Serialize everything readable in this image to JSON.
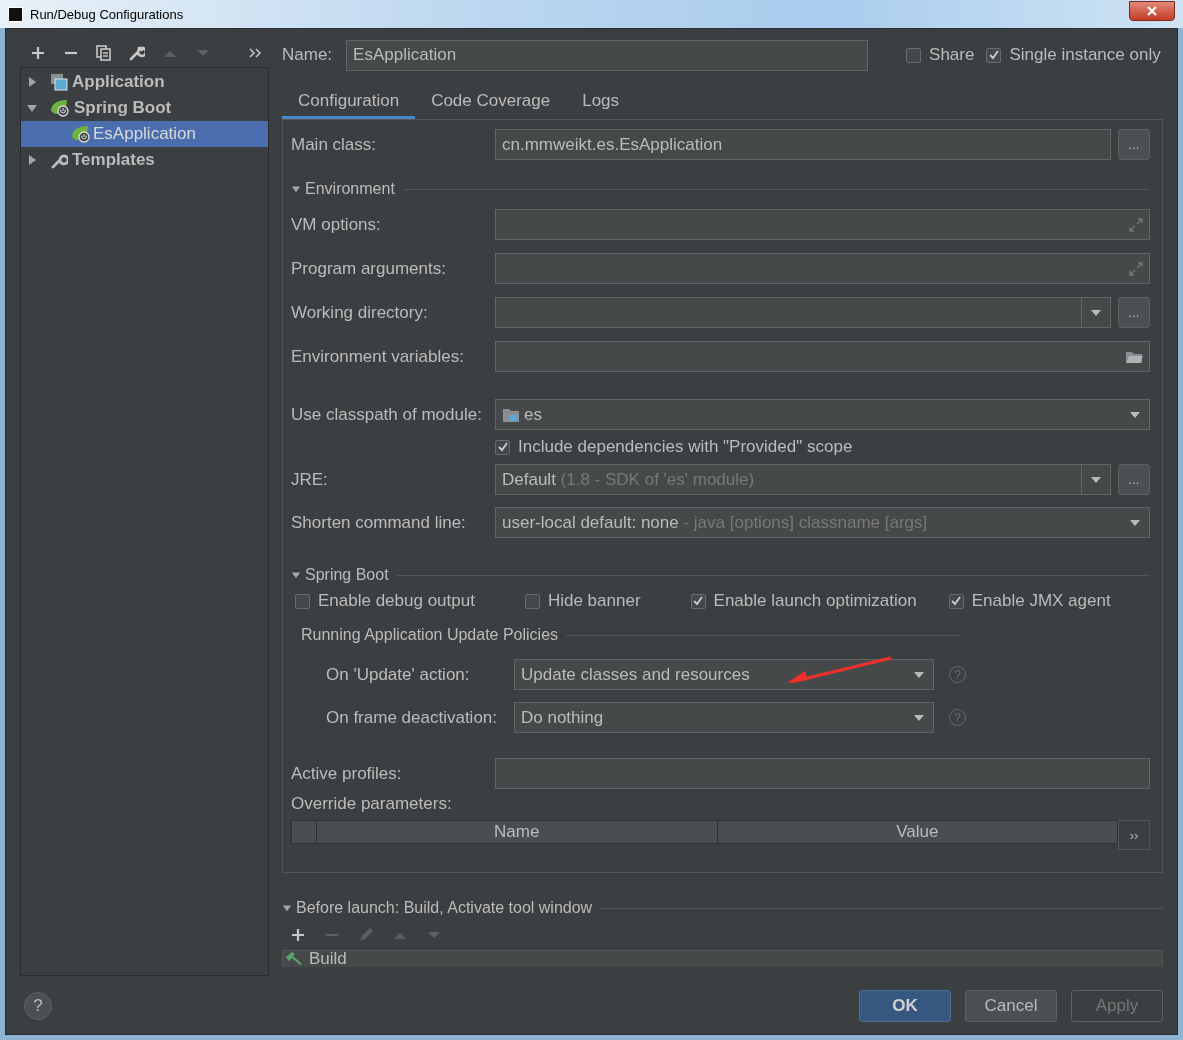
{
  "window": {
    "title": "Run/Debug Configurations"
  },
  "left_toolbar": [
    {
      "kind": "add",
      "disabled": false
    },
    {
      "kind": "remove",
      "disabled": false
    },
    {
      "kind": "copy",
      "disabled": false
    },
    {
      "kind": "wrench",
      "disabled": false
    },
    {
      "kind": "up",
      "disabled": true
    },
    {
      "kind": "down",
      "disabled": true
    },
    {
      "kind": "more",
      "disabled": false
    }
  ],
  "tree": [
    {
      "label": "Application",
      "kind": "application",
      "expanded": false,
      "selected": false
    },
    {
      "label": "Spring Boot",
      "kind": "spring",
      "expanded": true,
      "selected": false,
      "children": [
        {
          "label": "EsApplication",
          "kind": "spring",
          "selected": true
        }
      ]
    },
    {
      "label": "Templates",
      "kind": "wrench",
      "expanded": false,
      "selected": false
    }
  ],
  "name_field": {
    "label": "Name:",
    "value": "EsApplication"
  },
  "options": [
    {
      "label": "Share",
      "checked": false
    },
    {
      "label": "Single instance only",
      "checked": true
    }
  ],
  "tabs": [
    {
      "label": "Configuration",
      "selected": true
    },
    {
      "label": "Code Coverage",
      "selected": false
    },
    {
      "label": "Logs",
      "selected": false
    }
  ],
  "main_class": {
    "label": "Main class:",
    "value": "cn.mmweikt.es.EsApplication",
    "browse": "..."
  },
  "environment": {
    "title": "Environment",
    "expanded": true,
    "fields": [
      {
        "label": "VM options:",
        "kind": "expand"
      },
      {
        "label": "Program arguments:",
        "kind": "expand"
      },
      {
        "label": "Working directory:",
        "kind": "dropdown",
        "browse": "..."
      },
      {
        "label": "Environment variables:",
        "kind": "folder"
      }
    ]
  },
  "module": {
    "label": "Use classpath of module:",
    "value": "es"
  },
  "include_dependencies": {
    "label": "Include dependencies with \"Provided\" scope",
    "checked": true
  },
  "jre": {
    "label": "JRE:",
    "value": "Default",
    "hint": "(1.8 - SDK of 'es' module)",
    "browse": "..."
  },
  "shorten": {
    "label": "Shorten command line:",
    "value": "user-local default: none",
    "hint": "- java [options] classname [args]"
  },
  "spring_boot": {
    "title": "Spring Boot",
    "expanded": true,
    "checks": [
      {
        "label": "Enable debug output",
        "checked": false
      },
      {
        "label": "Hide banner",
        "checked": false
      },
      {
        "label": "Enable launch optimization",
        "checked": true
      },
      {
        "label": "Enable JMX agent",
        "checked": true
      }
    ],
    "policies": {
      "title": "Running Application Update Policies",
      "rows": [
        {
          "label": "On 'Update' action:",
          "value": "Update classes and resources",
          "help": "?"
        },
        {
          "label": "On frame deactivation:",
          "value": "Do nothing",
          "help": "?"
        }
      ]
    }
  },
  "active_profiles": {
    "label": "Active profiles:"
  },
  "override": {
    "label": "Override parameters:",
    "columns": [
      "Name",
      "Value"
    ],
    "more": "››"
  },
  "before_launch": {
    "title": "Before launch: Build, Activate tool window",
    "expanded": true,
    "toolbar": [
      {
        "kind": "add",
        "disabled": false
      },
      {
        "kind": "remove",
        "disabled": true
      },
      {
        "kind": "edit",
        "disabled": true
      },
      {
        "kind": "up",
        "disabled": true
      },
      {
        "kind": "down",
        "disabled": true
      }
    ],
    "tasks": [
      {
        "label": "Build"
      }
    ]
  },
  "help": "?",
  "buttons": [
    {
      "label": "OK",
      "kind": "primary",
      "disabled": false
    },
    {
      "label": "Cancel",
      "kind": "normal",
      "disabled": false
    },
    {
      "label": "Apply",
      "kind": "normal",
      "disabled": true
    }
  ]
}
